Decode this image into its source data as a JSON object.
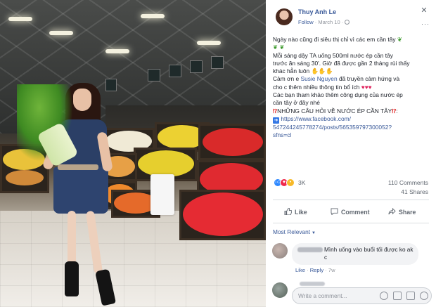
{
  "post": {
    "author": "Thuy Anh Le",
    "follow": "Follow",
    "date": "March 10",
    "close_icon": "close-icon",
    "more_icon": "more-options-icon"
  },
  "body": {
    "line1": "Ngày nào cũng đi siêu thị chỉ vì các em cần tây",
    "line2": "Mỗi sáng dậy TA uống 500ml nước ép cần tây",
    "line3": "trước ăn sáng 30'. Giờ đã được gần 2 tháng rùi thấy",
    "line4": "khác hẳn luôn",
    "line5a": "Cảm ơn e ",
    "mention": "Susie Nguyen",
    "line5b": " đã truyền cảm hứng và",
    "line6": "cho c thêm nhiều thông tin bổ ích",
    "line7": "Các bạn tham khảo thêm công dụng của nước ép",
    "line8": "cần tây ở đây nhé",
    "line9": "NHỮNG CÂU HỎI VỀ NƯỚC ÉP CẦN TÂY",
    "url1": "https://www.facebook.com/",
    "url2": "547244245778274/posts/565359797300052?",
    "url3": "sfns=cl"
  },
  "stats": {
    "reactions": "3K",
    "comments": "110 Comments",
    "shares": "41 Shares"
  },
  "actions": {
    "like": "Like",
    "comment": "Comment",
    "share": "Share"
  },
  "sort": {
    "label": "Most Relevant"
  },
  "comment": {
    "text": "Mình uống vào buổi tối được ko ak c",
    "like": "Like",
    "reply": "Reply",
    "time": "7w"
  },
  "composer": {
    "placeholder": "Write a comment..."
  },
  "colors": {
    "link": "#385898",
    "text": "#1d2129",
    "muted": "#90949c",
    "like_blue": "#2d88ff",
    "love_red": "#f0284a",
    "wow_yellow": "#f7b928"
  }
}
